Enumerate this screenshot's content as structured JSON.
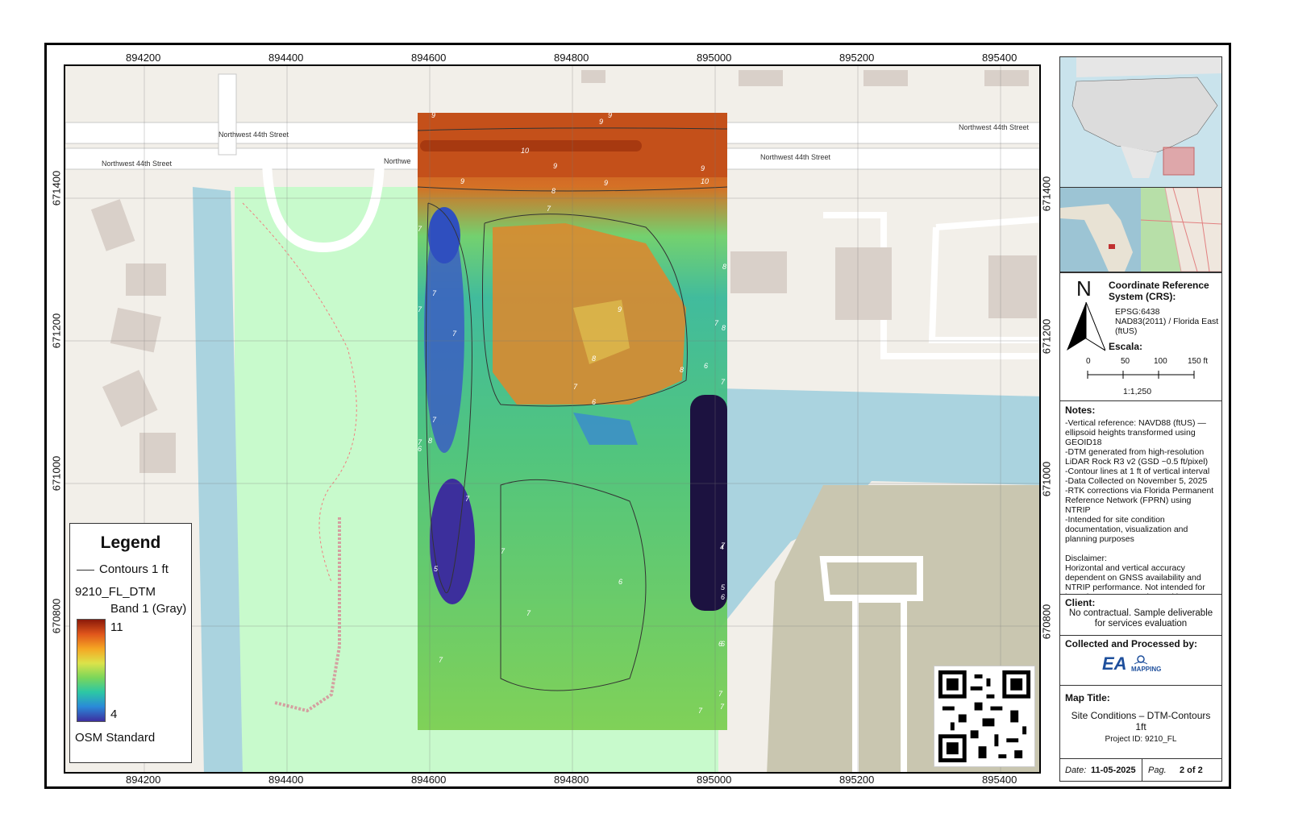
{
  "map": {
    "x_ticks": [
      "894200",
      "894400",
      "894600",
      "894800",
      "895000",
      "895200",
      "895400"
    ],
    "y_ticks": [
      "671400",
      "671200",
      "671000",
      "670800"
    ],
    "streets": [
      "Northwest 44th Street",
      "Northwest 44th Street",
      "Northwest 44th Street",
      "Northwest 44th Street",
      "Northwe"
    ],
    "contour_labels": [
      "9",
      "9",
      "9",
      "10",
      "9",
      "9",
      "9",
      "8",
      "10",
      "7",
      "9",
      "8",
      "7",
      "7",
      "7",
      "7",
      "9",
      "8",
      "7",
      "7",
      "6",
      "8",
      "7",
      "6",
      "8",
      "7",
      "6",
      "7",
      "6",
      "7",
      "5",
      "7",
      "6",
      "4",
      "5",
      "6",
      "7",
      "7",
      "7",
      "7",
      "7",
      "8",
      "7",
      "6"
    ]
  },
  "legend": {
    "title": "Legend",
    "contours": "Contours 1 ft",
    "layer": "9210_FL_DTM",
    "band": "Band 1 (Gray)",
    "max": "11",
    "min": "4",
    "basemap": "OSM Standard"
  },
  "crs": {
    "north": "N",
    "title": "Coordinate Reference System (CRS):",
    "epsg": "EPSG:6438",
    "name": "NAD83(2011) / Florida East (ftUS)",
    "scale_title": "Escala:",
    "scale_ticks": [
      "0",
      "50",
      "100",
      "150 ft"
    ],
    "ratio": "1:1,250"
  },
  "notes": {
    "title": "Notes:",
    "lines": [
      "-Vertical reference: NAVD88 (ftUS) — ellipsoid heights transformed using GEOID18",
      "-DTM generated from high-resolution LiDAR Rock R3 v2 (GSD ~0.5 ft/pixel)",
      "-Contour lines at 1 ft of vertical interval",
      "-Data Collected on November 5, 2025",
      "-RTK corrections via Florida Permanent Reference Network (FPRN) using NTRIP",
      "-Intended for site condition documentation, visualization and planning purposes"
    ],
    "disclaimer_title": "Disclaimer:",
    "disclaimer": "Horizontal and vertical accuracy dependent on GNSS availability and NTRIP performance. Not intended for boundary or construction staking."
  },
  "client": {
    "title": "Client:",
    "text": "No contractual. Sample deliverable for services evaluation"
  },
  "collected": {
    "title": "Collected and Processed by:",
    "logo": "EA",
    "logo_sub": "MAPPING"
  },
  "map_title": {
    "title": "Map Title:",
    "text": "Site Conditions – DTM-Contours 1ft",
    "project": "Project ID: 9210_FL"
  },
  "footer": {
    "date_label": "Date:",
    "date": "11-05-2025",
    "page_label": "Pag.",
    "page": "2 of 2"
  },
  "colors": {
    "water": "#aad3df",
    "park": "#c8facc",
    "building": "#d9d0c9",
    "road": "#ffffff",
    "land": "#f2efe9",
    "commercial": "#c9c6b0"
  }
}
